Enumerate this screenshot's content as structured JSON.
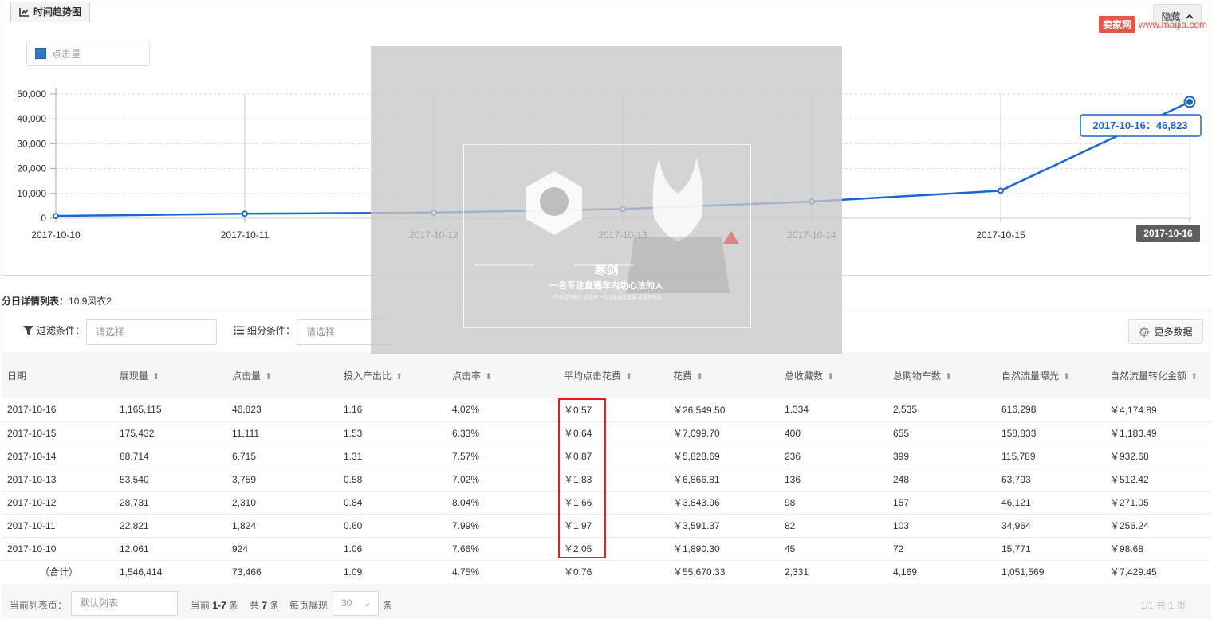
{
  "chart_panel": {
    "tab_label": "时间趋势图",
    "hide_label": "隐藏",
    "legend_label": "点击量"
  },
  "chart_data": {
    "type": "line",
    "x": [
      "2017-10-10",
      "2017-10-11",
      "2017-10-12",
      "2017-10-13",
      "2017-10-14",
      "2017-10-15",
      "2017-10-16"
    ],
    "series": [
      {
        "name": "点击量",
        "values": [
          924,
          1824,
          2310,
          3759,
          6715,
          11111,
          46823
        ]
      }
    ],
    "ylim": [
      0,
      50000
    ],
    "yticks": [
      "0",
      "10,000",
      "20,000",
      "30,000",
      "40,000",
      "50,000"
    ],
    "tooltip": "2017-10-16：46,823",
    "highlighted_x_label": "2017-10-16",
    "line_color": "#1a66d0",
    "grid": true
  },
  "watermark": {
    "name": "寒剑",
    "slogan": "一名专注直通车内功心法的人",
    "sub": "• 内功宝贝图片 点击率          • 心法直通车思维 直通车玩法"
  },
  "section": {
    "title_label": "分日详情列表：",
    "title_value": "10.9风衣2"
  },
  "filter": {
    "filter_label": "过滤条件：",
    "filter_placeholder": "请选择",
    "segment_label": "细分条件：",
    "segment_placeholder": "请选择",
    "more_data_label": "更多数据"
  },
  "table": {
    "columns": [
      "日期",
      "展现量",
      "点击量",
      "投入产出比",
      "点击率",
      "平均点击花费",
      "花费",
      "总收藏数",
      "总购物车数",
      "自然流量曝光",
      "自然流量转化金额"
    ],
    "rows": [
      [
        "2017-10-16",
        "1,165,115",
        "46,823",
        "1.16",
        "4.02%",
        "￥0.57",
        "￥26,549.50",
        "1,334",
        "2,535",
        "616,298",
        "￥4,174.89"
      ],
      [
        "2017-10-15",
        "175,432",
        "11,111",
        "1.53",
        "6.33%",
        "￥0.64",
        "￥7,099.70",
        "400",
        "655",
        "158,833",
        "￥1,183.49"
      ],
      [
        "2017-10-14",
        "88,714",
        "6,715",
        "1.31",
        "7.57%",
        "￥0.87",
        "￥5,828.69",
        "236",
        "399",
        "115,789",
        "￥932.68"
      ],
      [
        "2017-10-13",
        "53,540",
        "3,759",
        "0.58",
        "7.02%",
        "￥1.83",
        "￥6,866.81",
        "136",
        "248",
        "63,793",
        "￥512.42"
      ],
      [
        "2017-10-12",
        "28,731",
        "2,310",
        "0.84",
        "8.04%",
        "￥1.66",
        "￥3,843.96",
        "98",
        "157",
        "46,121",
        "￥271.05"
      ],
      [
        "2017-10-11",
        "22,821",
        "1,824",
        "0.60",
        "7.99%",
        "￥1.97",
        "￥3,591.37",
        "82",
        "103",
        "34,964",
        "￥256.24"
      ],
      [
        "2017-10-10",
        "12,061",
        "924",
        "1.06",
        "7.66%",
        "￥2.05",
        "￥1,890.30",
        "45",
        "72",
        "15,771",
        "￥98.68"
      ]
    ],
    "total": [
      "（合计）",
      "1,546,414",
      "73,466",
      "1.09",
      "4.75%",
      "￥0.76",
      "￥55,670.33",
      "2,331",
      "4,169",
      "1,051,569",
      "￥7,429.45"
    ]
  },
  "pager": {
    "list_page_label": "当前列表页：",
    "list_page_value": "默认列表",
    "current_prefix": "当前",
    "current_range": "1-7",
    "current_unit": "条",
    "total_prefix": "共",
    "total_count": "7",
    "total_unit": "条",
    "page_size_label": "每页展现",
    "page_size_value": "30",
    "page_size_unit": "条",
    "page_info": "1/1   共 1 页"
  },
  "site_logo": {
    "badge": "卖家网",
    "url": "www.maijia.com"
  },
  "colors": {
    "line": "#1a66d0",
    "highlight_box": "#e02020",
    "logo": "#e8554a"
  }
}
